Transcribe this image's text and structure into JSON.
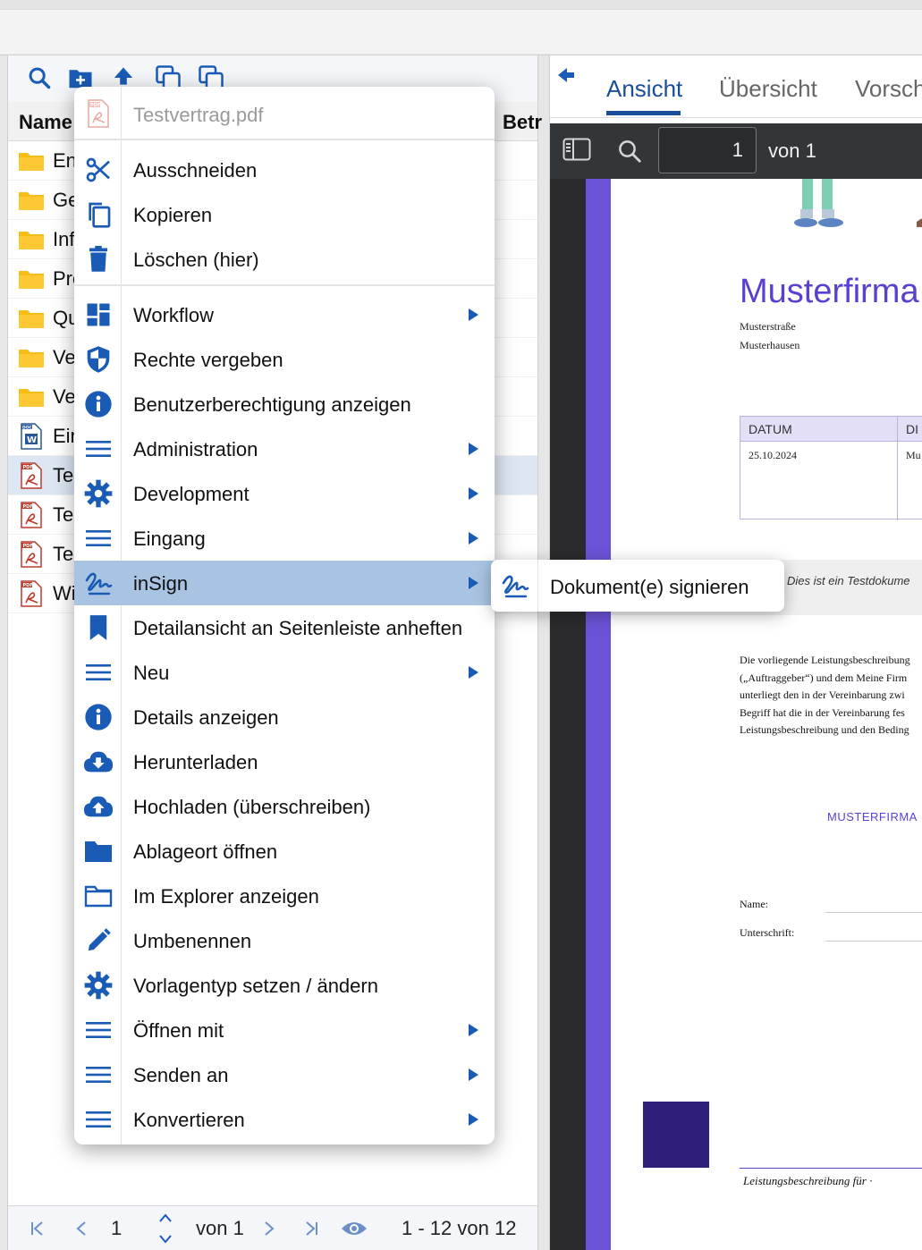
{
  "left": {
    "columns": {
      "name": "Name",
      "second": "Betr"
    },
    "rows": [
      {
        "label": "En",
        "icon": "folder-icon"
      },
      {
        "label": "Ge",
        "icon": "folder-icon"
      },
      {
        "label": "Inf",
        "icon": "folder-icon"
      },
      {
        "label": "Pro",
        "icon": "folder-icon"
      },
      {
        "label": "Qu",
        "icon": "folder-icon"
      },
      {
        "label": "Ve",
        "icon": "folder-icon"
      },
      {
        "label": "Ve",
        "icon": "folder-icon"
      },
      {
        "label": "Ein",
        "icon": "word-file-icon"
      },
      {
        "label": "Tes",
        "icon": "pdf-file-icon"
      },
      {
        "label": "Tes",
        "icon": "pdf-file-icon"
      },
      {
        "label": "Tes",
        "icon": "pdf-file-icon"
      },
      {
        "label": "Wi",
        "icon": "pdf-file-icon"
      }
    ],
    "pager": {
      "page": "1",
      "of": "von 1",
      "range": "1 - 12 von 12"
    }
  },
  "menu": {
    "filename": "Testvertrag.pdf",
    "items": [
      {
        "label": "Ausschneiden",
        "icon": "scissors-icon"
      },
      {
        "label": "Kopieren",
        "icon": "copy-icon"
      },
      {
        "label": "Löschen (hier)",
        "icon": "trash-icon"
      },
      {
        "label": "Workflow",
        "icon": "dashboard-icon"
      },
      {
        "label": "Rechte vergeben",
        "icon": "shield-icon"
      },
      {
        "label": "Benutzerberechtigung anzeigen",
        "icon": "info-icon"
      },
      {
        "label": "Administration",
        "icon": "menu-lines-icon"
      },
      {
        "label": "Development",
        "icon": "gear-icon"
      },
      {
        "label": "Eingang",
        "icon": "menu-lines-icon"
      },
      {
        "label": "inSign",
        "icon": "signature-icon"
      },
      {
        "label": "Detailansicht an Seitenleiste anheften",
        "icon": "bookmark-icon"
      },
      {
        "label": "Neu",
        "icon": "menu-lines-icon"
      },
      {
        "label": "Details anzeigen",
        "icon": "info-icon"
      },
      {
        "label": "Herunterladen",
        "icon": "cloud-download-icon"
      },
      {
        "label": "Hochladen (überschreiben)",
        "icon": "cloud-upload-icon"
      },
      {
        "label": "Ablageort öffnen",
        "icon": "folder-filled-icon"
      },
      {
        "label": "Im Explorer anzeigen",
        "icon": "folder-outline-icon"
      },
      {
        "label": "Umbenennen",
        "icon": "pencil-icon"
      },
      {
        "label": "Vorlagentyp setzen / ändern",
        "icon": "gear-icon"
      },
      {
        "label": "Öffnen mit",
        "icon": "menu-lines-icon"
      },
      {
        "label": "Senden an",
        "icon": "menu-lines-icon"
      },
      {
        "label": "Konvertieren",
        "icon": "menu-lines-icon"
      }
    ],
    "submenu": {
      "label": "Dokument(e) signieren",
      "icon": "signature-icon"
    }
  },
  "right": {
    "tabs": [
      "Ansicht",
      "Übersicht",
      "Vorsch"
    ],
    "pdf_page": "1",
    "pdf_of": "von 1",
    "doc": {
      "title": "Musterfirma",
      "street": "Musterstraße",
      "city": "Musterhausen",
      "table_head_left": "DATUM",
      "table_head_right": "DI",
      "date": "25.10.2024",
      "table_cell_right": "Mu",
      "note": "Dies ist ein Testdokume",
      "body_lines": [
        "Die vorliegende Leistungsbeschreibung",
        "(„Auftraggeber“) und dem Meine Firm",
        "unterliegt den in der Vereinbarung zwi",
        "Begriff hat die in der Vereinbarung fes",
        "Leistungsbeschreibung und den Beding"
      ],
      "company_caps": "MUSTERFIRMA",
      "name_label": "Name:",
      "signature_label": "Unterschrift:",
      "footer": "Leistungsbeschreibung für ·"
    }
  },
  "colors": {
    "accent": "#1a5bb5",
    "tab_active": "#1a4e9c",
    "highlight": "#a9c4e3",
    "brand_purple": "#5d3fcf"
  }
}
